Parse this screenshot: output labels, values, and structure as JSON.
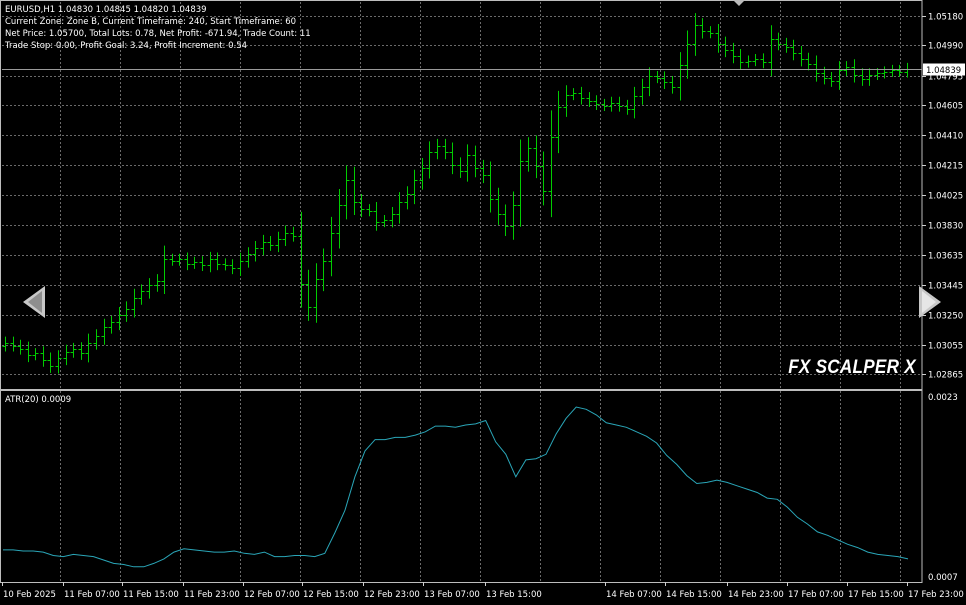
{
  "header": {
    "symbol_line": "EURUSD,H1  1.04830 1.04845 1.04820 1.04839",
    "info_lines": [
      "Current Zone: Zone B, Current Timeframe: 240, Start Timeframe: 60",
      "Net Price: 1.05700, Total Lots: 0.78, Net Profit: -671.94, Trade Count: 11",
      "Trade Stop: 0.00, Profit Goal: 3.24, Profit Increment: 0.54"
    ]
  },
  "brand": "FX SCALPER X",
  "nav": {
    "left_icon": "chevron-left-icon",
    "right_icon": "chevron-right-icon"
  },
  "colors": {
    "candle": "#00cc00",
    "atr_line": "#2aa6b8",
    "grid": "#6a6a6a",
    "background": "#000000"
  },
  "chart_data": [
    {
      "type": "candlestick",
      "symbol": "EURUSD",
      "timeframe": "H1",
      "last_price_label": "1.04839",
      "ylim": [
        1.0277,
        1.0527
      ],
      "y_ticks": [
        "1.05180",
        "1.04990",
        "1.04795",
        "1.04605",
        "1.04410",
        "1.04215",
        "1.04025",
        "1.03830",
        "1.03635",
        "1.03445",
        "1.03250",
        "1.03055",
        "1.02865"
      ],
      "x_ticks": [
        "10 Feb 2025",
        "11 Feb 07:00",
        "11 Feb 15:00",
        "11 Feb 23:00",
        "12 Feb 07:00",
        "12 Feb 15:00",
        "12 Feb 23:00",
        "13 Feb 07:00",
        "13 Feb 15:00",
        "14 Feb 07:00",
        "14 Feb 15:00",
        "14 Feb 23:00",
        "17 Feb 07:00",
        "17 Feb 15:00",
        "17 Feb 23:00"
      ],
      "closes": [
        1.0307,
        1.0305,
        1.0303,
        1.0299,
        1.03,
        1.0296,
        1.0292,
        1.0297,
        1.0301,
        1.0303,
        1.03,
        1.0307,
        1.0311,
        1.0317,
        1.032,
        1.0325,
        1.0329,
        1.0336,
        1.034,
        1.0344,
        1.0347,
        1.0361,
        1.036,
        1.0361,
        1.0358,
        1.0359,
        1.0357,
        1.0361,
        1.0358,
        1.0357,
        1.0355,
        1.036,
        1.0364,
        1.0368,
        1.0372,
        1.037,
        1.0374,
        1.0378,
        1.0376,
        1.0345,
        1.033,
        1.0348,
        1.036,
        1.0378,
        1.0396,
        1.0412,
        1.0398,
        1.0393,
        1.0392,
        1.0385,
        1.0386,
        1.039,
        1.0398,
        1.0403,
        1.0412,
        1.042,
        1.043,
        1.0434,
        1.043,
        1.0422,
        1.0418,
        1.0428,
        1.042,
        1.0415,
        1.04,
        1.039,
        1.0382,
        1.0396,
        1.0424,
        1.0433,
        1.0421,
        1.0405,
        1.044,
        1.0459,
        1.0467,
        1.0468,
        1.0465,
        1.0463,
        1.0461,
        1.046,
        1.0462,
        1.046,
        1.0458,
        1.0466,
        1.0472,
        1.0479,
        1.0478,
        1.0475,
        1.0472,
        1.0486,
        1.05,
        1.0512,
        1.0508,
        1.0507,
        1.05,
        1.0496,
        1.0492,
        1.0488,
        1.0489,
        1.049,
        1.0488,
        1.0503,
        1.05,
        1.0498,
        1.0494,
        1.049,
        1.0487,
        1.0481,
        1.0478,
        1.0476,
        1.0483,
        1.0485,
        1.048,
        1.0477,
        1.048,
        1.0481,
        1.0482,
        1.0483,
        1.0482,
        1.04839
      ]
    },
    {
      "type": "line",
      "indicator": "ATR(20)",
      "title": "ATR(20) 0.0009",
      "ylim": [
        0.0007,
        0.0023
      ],
      "y_ticks": [
        "0.0023",
        "0.0007"
      ],
      "values": [
        0.00095,
        0.00095,
        0.00094,
        0.00094,
        0.00093,
        0.0009,
        0.00089,
        0.00091,
        0.0009,
        0.00089,
        0.00086,
        0.00083,
        0.00082,
        0.0008,
        0.0008,
        0.00083,
        0.00087,
        0.00093,
        0.00096,
        0.00095,
        0.00094,
        0.00093,
        0.00093,
        0.00094,
        0.00092,
        0.00091,
        0.00093,
        0.00089,
        0.00089,
        0.0009,
        0.0009,
        0.00089,
        0.00092,
        0.0011,
        0.0013,
        0.0016,
        0.00183,
        0.00193,
        0.00193,
        0.00195,
        0.00195,
        0.00197,
        0.002,
        0.00205,
        0.00205,
        0.00204,
        0.00206,
        0.00207,
        0.0021,
        0.00191,
        0.0018,
        0.0016,
        0.00175,
        0.00176,
        0.0018,
        0.00198,
        0.00212,
        0.00222,
        0.0022,
        0.00215,
        0.00208,
        0.00206,
        0.00204,
        0.002,
        0.00196,
        0.0019,
        0.00179,
        0.00171,
        0.00161,
        0.00154,
        0.00155,
        0.00157,
        0.00155,
        0.00152,
        0.00149,
        0.00146,
        0.00141,
        0.0014,
        0.00133,
        0.00124,
        0.00118,
        0.00111,
        0.00108,
        0.00104,
        0.001,
        0.00097,
        0.00093,
        0.00091,
        0.0009,
        0.00089,
        0.00087
      ]
    }
  ]
}
